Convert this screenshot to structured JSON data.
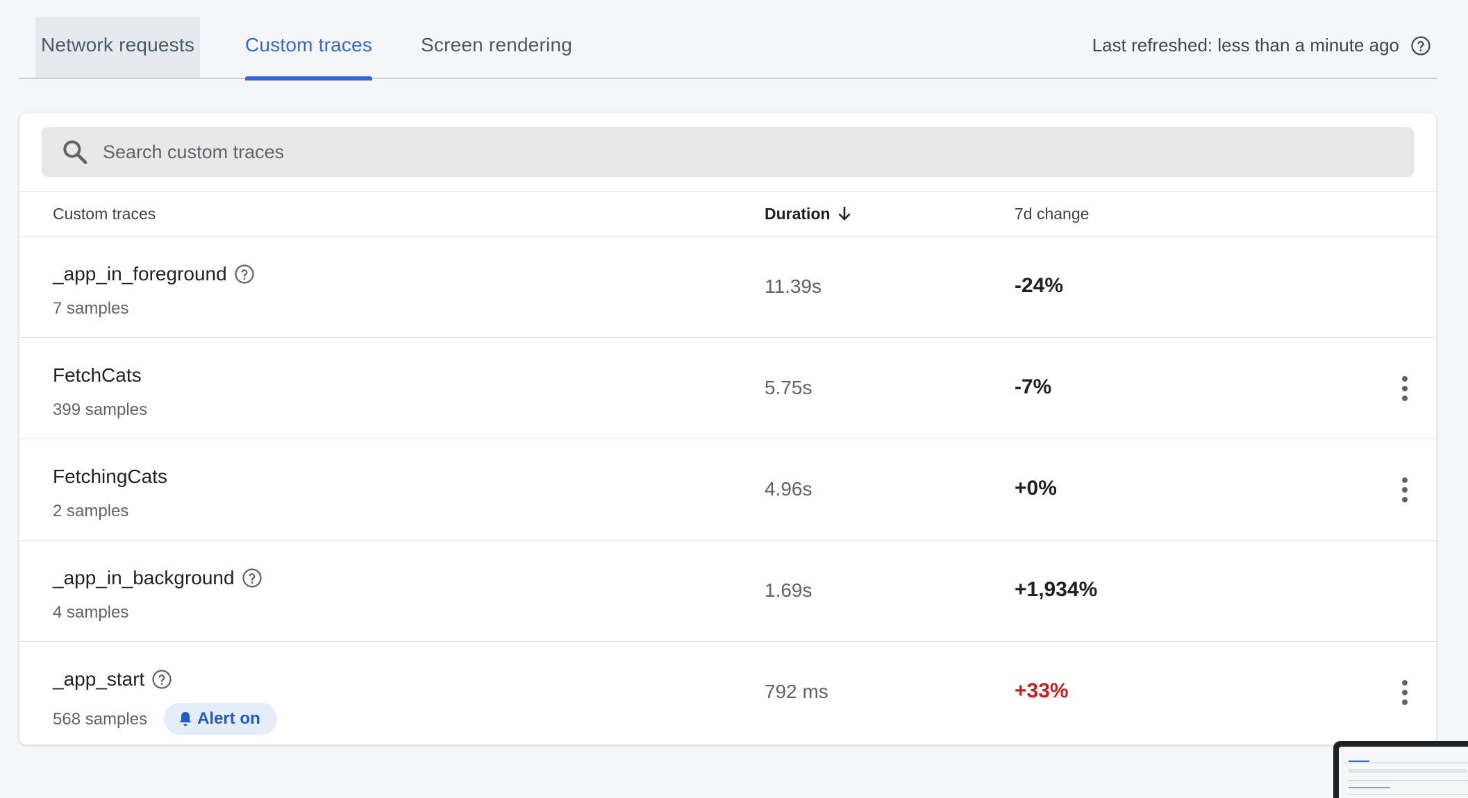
{
  "tabs": [
    {
      "label": "Network requests"
    },
    {
      "label": "Custom traces"
    },
    {
      "label": "Screen rendering"
    }
  ],
  "refresh_text": "Last refreshed: less than a minute ago",
  "search": {
    "placeholder": "Search custom traces"
  },
  "table": {
    "headers": {
      "name": "Custom traces",
      "duration": "Duration",
      "change": "7d change"
    },
    "rows": [
      {
        "name": "_app_in_foreground",
        "samples": "7 samples",
        "duration": "11.39s",
        "change": "-24%",
        "help": true,
        "menu": false,
        "alert": false
      },
      {
        "name": "FetchCats",
        "samples": "399 samples",
        "duration": "5.75s",
        "change": "-7%",
        "help": false,
        "menu": true,
        "alert": false
      },
      {
        "name": "FetchingCats",
        "samples": "2 samples",
        "duration": "4.96s",
        "change": "+0%",
        "help": false,
        "menu": true,
        "alert": false
      },
      {
        "name": "_app_in_background",
        "samples": "4 samples",
        "duration": "1.69s",
        "change": "+1,934%",
        "help": true,
        "menu": false,
        "alert": false
      },
      {
        "name": "_app_start",
        "samples": "568 samples",
        "duration": "792 ms",
        "change": "+33%",
        "help": true,
        "menu": true,
        "alert": true,
        "alert_label": "Alert on",
        "change_status": "regression"
      }
    ]
  },
  "colors": {
    "accent": "#3367d6",
    "regression": "#c5221f",
    "badge_bg": "#e5edfb"
  },
  "icons": {
    "search": "search-icon",
    "help": "help-circle-icon",
    "sort": "arrow-down-icon",
    "menu": "more-vert-icon",
    "bell": "bell-icon"
  }
}
